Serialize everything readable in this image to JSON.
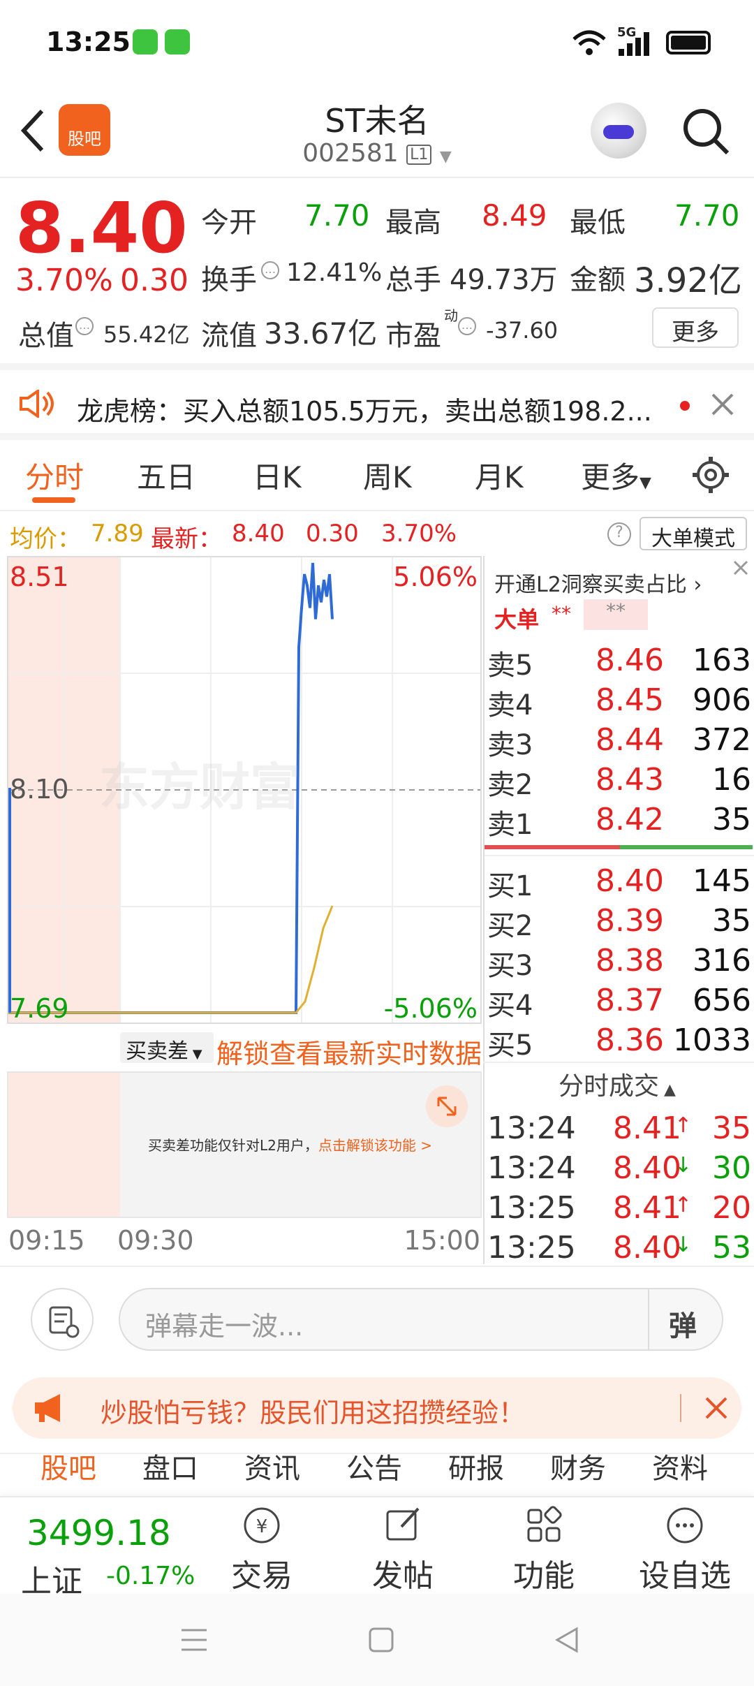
{
  "status_bar": {
    "time": "13:25",
    "network": "5G"
  },
  "header": {
    "app_badge": "股吧",
    "title": "ST未名",
    "code": "002581",
    "level": "L1"
  },
  "quote": {
    "price": "8.40",
    "change_pct": "3.70%",
    "change": "0.30",
    "open_label": "今开",
    "open": "7.70",
    "high_label": "最高",
    "high": "8.49",
    "low_label": "最低",
    "low": "7.70",
    "turnover_label": "换手",
    "turnover": "12.41%",
    "volume_label": "总手",
    "volume": "49.73万",
    "amount_label": "金额",
    "amount": "3.92亿",
    "mktcap_label": "总值",
    "mktcap": "55.42亿",
    "float_label": "流值",
    "float": "33.67亿",
    "pe_label": "市盈",
    "pe_sup": "动",
    "pe": "-37.60",
    "more_label": "更多"
  },
  "notice": {
    "text": "龙虎榜：买入总额105.5万元，卖出总额198.2..."
  },
  "tabs": [
    "分时",
    "五日",
    "日K",
    "周K",
    "月K",
    "更多"
  ],
  "info_bar": {
    "avg_label": "均价：",
    "avg": "7.89",
    "latest_label": "最新：",
    "latest": "8.40",
    "change": "0.30",
    "pct": "3.70%",
    "mode_label": "大单模式"
  },
  "chart_data": {
    "type": "line",
    "ylim": [
      7.69,
      8.51
    ],
    "y_top_label": "8.51",
    "y_mid_label": "8.10",
    "y_bottom_label": "7.69",
    "pct_top_label": "5.06%",
    "pct_bottom_label": "-5.06%",
    "x_labels": [
      "09:15",
      "09:30",
      "15:00"
    ],
    "watermark": "东方财富",
    "series": [
      {
        "values": [
          7.7,
          7.7,
          7.7,
          8.35,
          8.42,
          8.48,
          8.46,
          8.42,
          8.5,
          8.4,
          8.46,
          8.43,
          8.47,
          8.44,
          8.48,
          8.4
        ]
      },
      {
        "values": [
          7.7,
          7.7,
          7.7,
          7.72,
          7.78,
          7.85,
          7.89
        ]
      }
    ]
  },
  "sub_chart": {
    "selector": "买卖差",
    "unlock_link": "解锁查看最新实时数据",
    "notice": "买卖差功能仅针对L2用户，",
    "notice_link": "点击解锁该功能 >"
  },
  "order_book": {
    "promo": "开通L2洞察买卖占比",
    "big_label": "大单",
    "big_mask1": "**",
    "big_mask2": "**",
    "asks": [
      {
        "label": "卖5",
        "price": "8.46",
        "vol": "163"
      },
      {
        "label": "卖4",
        "price": "8.45",
        "vol": "906"
      },
      {
        "label": "卖3",
        "price": "8.44",
        "vol": "372"
      },
      {
        "label": "卖2",
        "price": "8.43",
        "vol": "16"
      },
      {
        "label": "卖1",
        "price": "8.42",
        "vol": "35"
      }
    ],
    "bids": [
      {
        "label": "买1",
        "price": "8.40",
        "vol": "145"
      },
      {
        "label": "买2",
        "price": "8.39",
        "vol": "35"
      },
      {
        "label": "买3",
        "price": "8.38",
        "vol": "316"
      },
      {
        "label": "买4",
        "price": "8.37",
        "vol": "656"
      },
      {
        "label": "买5",
        "price": "8.36",
        "vol": "1033"
      }
    ]
  },
  "trades": {
    "header": "分时成交",
    "rows": [
      {
        "time": "13:24",
        "price": "8.41",
        "arrow": "↑",
        "vol": "35",
        "dir": "up"
      },
      {
        "time": "13:24",
        "price": "8.40",
        "arrow": "↓",
        "vol": "30",
        "dir": "down"
      },
      {
        "time": "13:25",
        "price": "8.41",
        "arrow": "↑",
        "vol": "20",
        "dir": "up"
      },
      {
        "time": "13:25",
        "price": "8.40",
        "arrow": "↓",
        "vol": "53",
        "dir": "down"
      }
    ]
  },
  "comment": {
    "placeholder": "弹幕走一波...",
    "danmu_label": "弹"
  },
  "ad": {
    "text": "炒股怕亏钱？股民们用这招攒经验！"
  },
  "sub_tabs": [
    "股吧",
    "盘口",
    "资讯",
    "公告",
    "研报",
    "财务",
    "资料"
  ],
  "bottom": {
    "index_value": "3499.18",
    "index_name": "上证",
    "index_change": "-0.17%",
    "items": [
      "交易",
      "发帖",
      "功能",
      "设自选"
    ]
  },
  "colors": {
    "up": "#e52222",
    "down": "#0aa00a",
    "accent": "#f0621d"
  }
}
